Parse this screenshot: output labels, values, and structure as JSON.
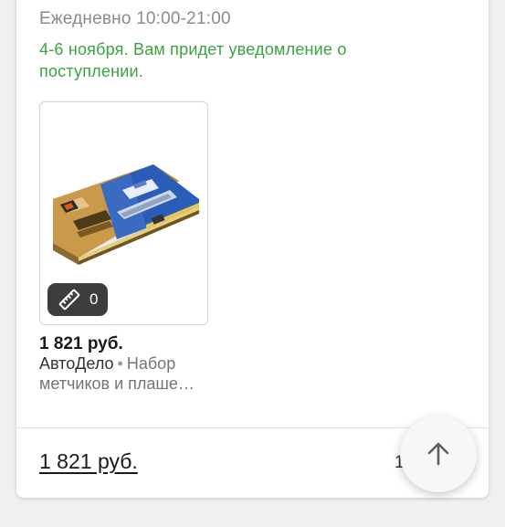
{
  "store": {
    "schedule": "Ежедневно 10:00-21:00",
    "delivery_note": "4-6 ноября. Вам придет уведомление о поступлении."
  },
  "product": {
    "image_icon": "product-photo",
    "badge_icon": "ruler-icon",
    "badge_count": "0",
    "price": "1 821 руб.",
    "brand": "АвтоДело",
    "separator": "•",
    "name": "Набор метчиков и плаше…"
  },
  "footer": {
    "total": "1 821 руб.",
    "partial_text": "1",
    "scroll_top_icon": "arrow-up-icon"
  },
  "colors": {
    "delivery_green": "#3aa443",
    "badge_bg": "#3d3d3d"
  }
}
